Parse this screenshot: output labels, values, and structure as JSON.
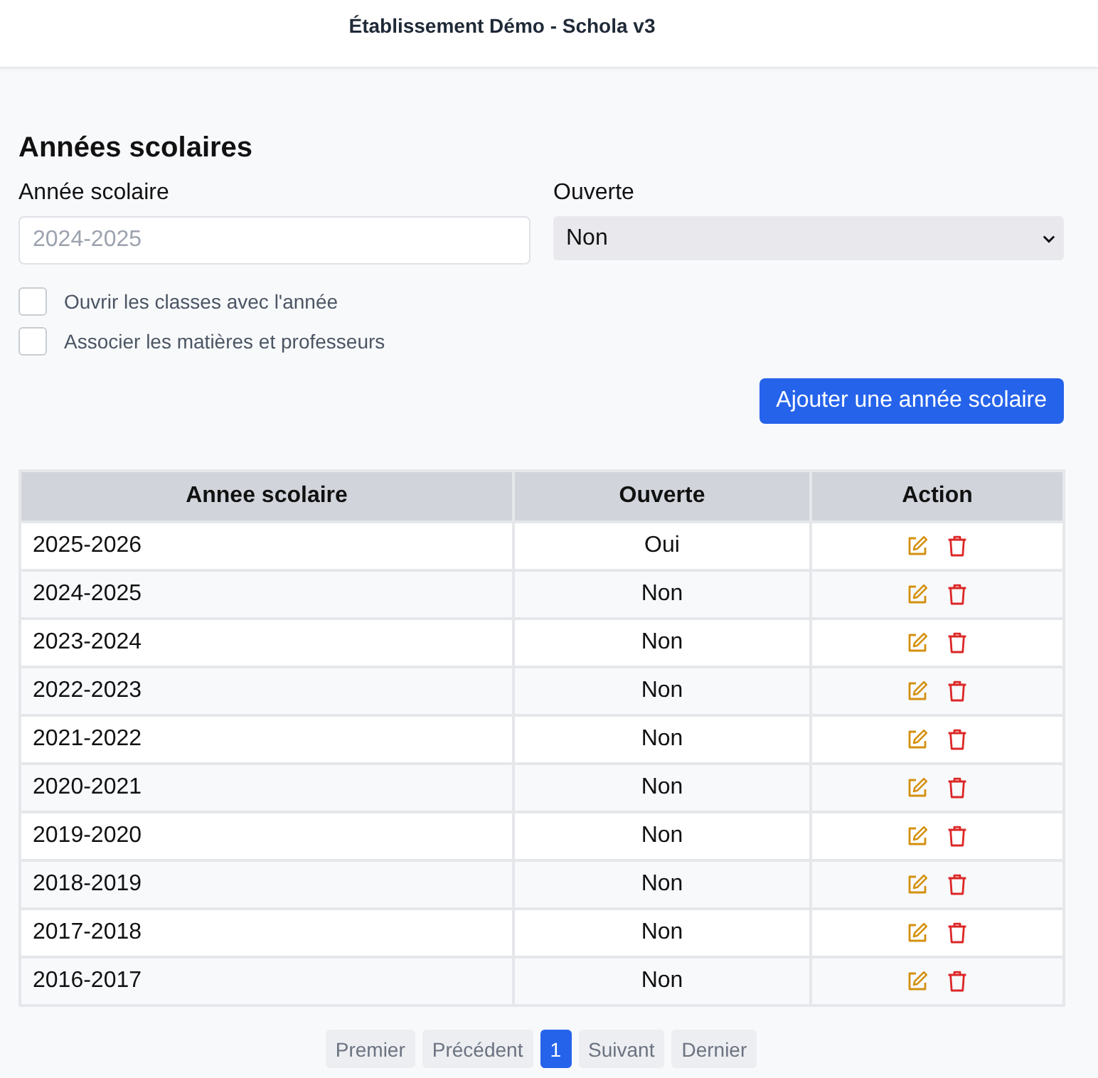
{
  "header": {
    "title": "Établissement Démo - Schola v3"
  },
  "form": {
    "heading": "Années scolaires",
    "year_field": {
      "label": "Année scolaire",
      "placeholder": "2024-2025"
    },
    "open_field": {
      "label": "Ouverte",
      "value": "Non"
    },
    "checkboxes": [
      {
        "label": "Ouvrir les classes avec l'année",
        "checked": false
      },
      {
        "label": "Associer les matières et professeurs",
        "checked": false
      }
    ],
    "submit": "Ajouter une année scolaire"
  },
  "table": {
    "columns": [
      "Annee scolaire",
      "Ouverte",
      "Action"
    ],
    "rows": [
      {
        "year": "2025-2026",
        "open": "Oui"
      },
      {
        "year": "2024-2025",
        "open": "Non"
      },
      {
        "year": "2023-2024",
        "open": "Non"
      },
      {
        "year": "2022-2023",
        "open": "Non"
      },
      {
        "year": "2021-2022",
        "open": "Non"
      },
      {
        "year": "2020-2021",
        "open": "Non"
      },
      {
        "year": "2019-2020",
        "open": "Non"
      },
      {
        "year": "2018-2019",
        "open": "Non"
      },
      {
        "year": "2017-2018",
        "open": "Non"
      },
      {
        "year": "2016-2017",
        "open": "Non"
      }
    ]
  },
  "pagination": [
    {
      "label": "Premier",
      "selected": false
    },
    {
      "label": "Précédent",
      "selected": false
    },
    {
      "label": "1",
      "selected": true
    },
    {
      "label": "Suivant",
      "selected": false
    },
    {
      "label": "Dernier",
      "selected": false
    }
  ]
}
